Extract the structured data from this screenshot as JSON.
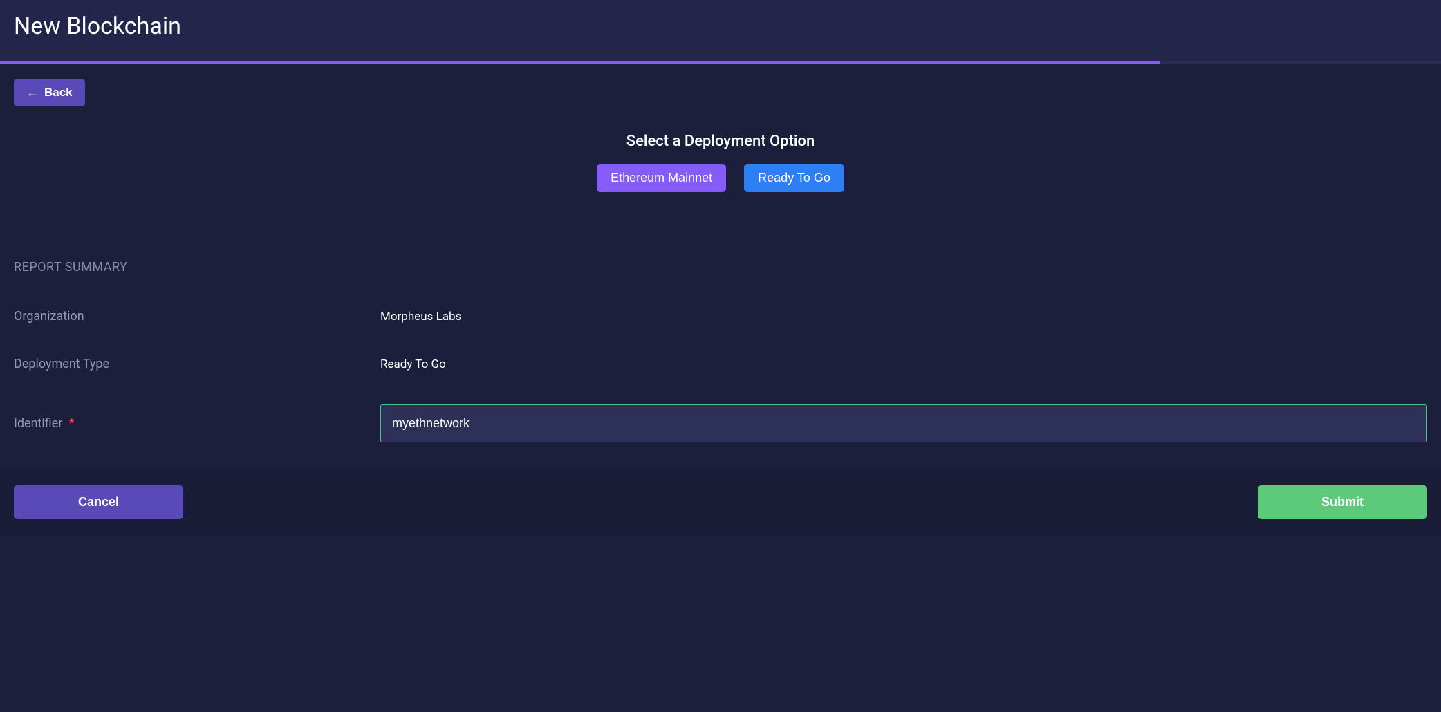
{
  "header": {
    "title": "New Blockchain"
  },
  "navigation": {
    "back_label": "Back"
  },
  "deployment": {
    "title": "Select a Deployment Option",
    "options": {
      "ethereum": "Ethereum Mainnet",
      "ready": "Ready To Go"
    }
  },
  "report": {
    "section_title": "REPORT SUMMARY",
    "rows": {
      "organization": {
        "label": "Organization",
        "value": "Morpheus Labs"
      },
      "deployment_type": {
        "label": "Deployment Type",
        "value": "Ready To Go"
      },
      "identifier": {
        "label": "Identifier",
        "value": "myethnetwork",
        "required_marker": "*"
      }
    }
  },
  "footer": {
    "cancel_label": "Cancel",
    "submit_label": "Submit"
  },
  "progress": {
    "percent": 80.5
  }
}
